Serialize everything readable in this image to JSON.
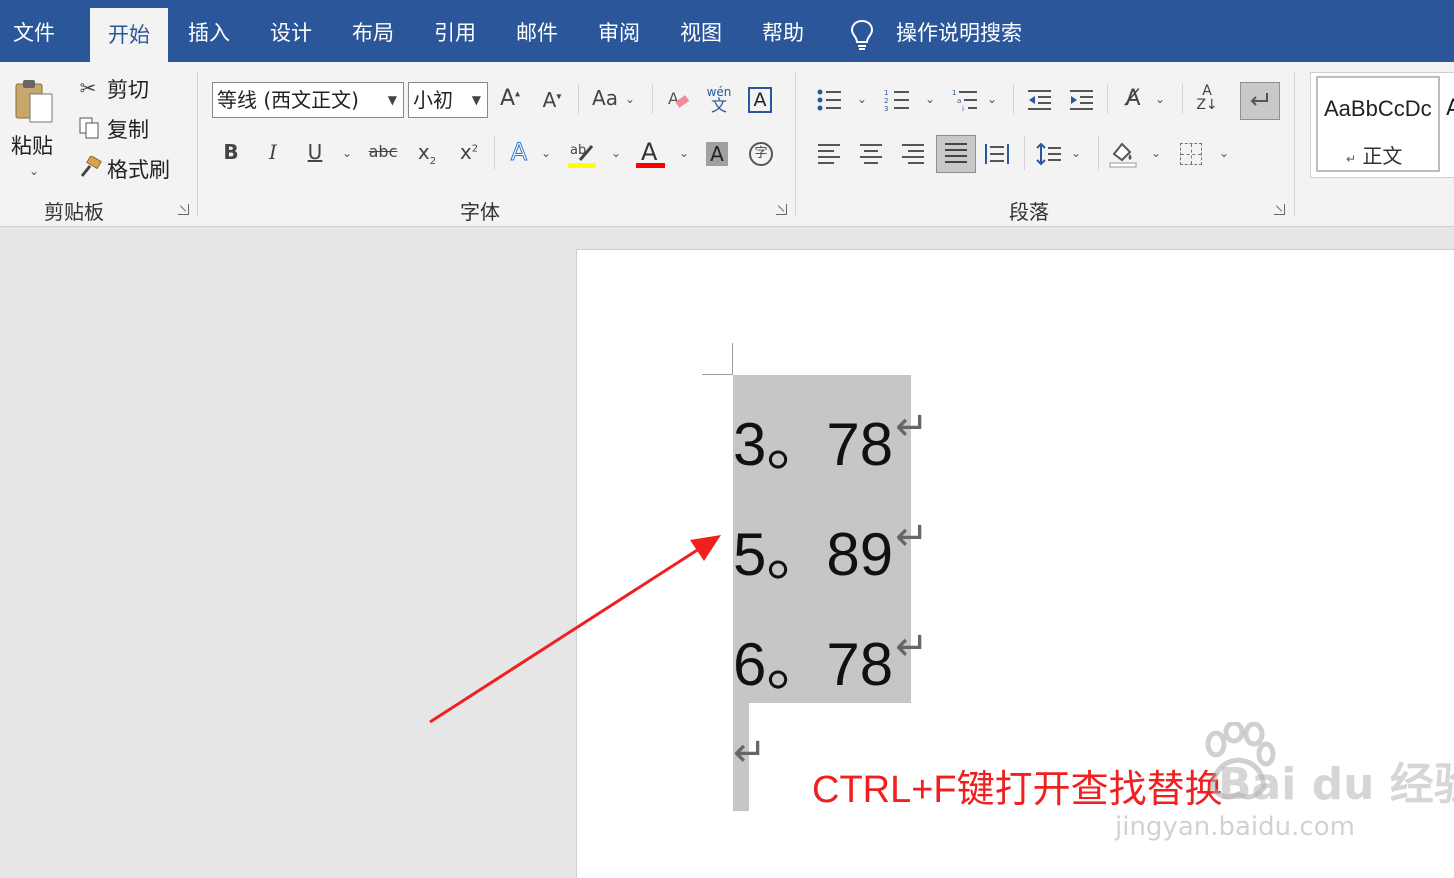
{
  "menu": {
    "tabs": [
      "文件",
      "开始",
      "插入",
      "设计",
      "布局",
      "引用",
      "邮件",
      "审阅",
      "视图",
      "帮助"
    ],
    "active_tab": "开始",
    "search_label": "操作说明搜索"
  },
  "ribbon": {
    "clipboard": {
      "paste": "粘贴",
      "cut": "剪切",
      "copy": "复制",
      "format_painter": "格式刷",
      "group_label": "剪贴板"
    },
    "font": {
      "font_name": "等线 (西文正文)",
      "font_size": "小初",
      "change_case": "Aa",
      "group_label": "字体"
    },
    "paragraph": {
      "group_label": "段落"
    },
    "styles": {
      "preview": "AaBbCcDc",
      "name": "正文"
    }
  },
  "document": {
    "lines": [
      "3。78",
      "5。89",
      "6。78"
    ]
  },
  "annotation": "CTRL+F键打开查找替换",
  "watermark": {
    "brand": "Bai du 经验",
    "url": "jingyan.baidu.com"
  },
  "colors": {
    "title_bar": "#2b579a",
    "annotation": "#f02020",
    "highlight": "#ffff00",
    "font_color": "#ff0000",
    "selection": "#c6c6c6"
  }
}
